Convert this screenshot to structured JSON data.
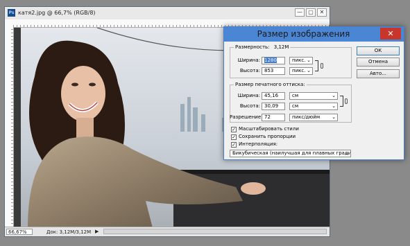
{
  "document": {
    "title": "катя2.jpg @ 66,7% (RGB/8)",
    "zoom": "66,67%",
    "doc_size": "Док: 3,12M/3,12M",
    "window_buttons": [
      "—",
      "▢",
      "✕"
    ]
  },
  "dialog": {
    "title": "Размер изображения",
    "close_glyph": "✕",
    "pixel_dimensions": {
      "label": "Размерность:",
      "size": "3,12M",
      "width_label": "Ширина:",
      "width_value": "1280",
      "width_unit": "пикс.",
      "height_label": "Высота:",
      "height_value": "853",
      "height_unit": "пикс."
    },
    "document_size": {
      "label": "Размер печатного оттиска:",
      "width_label": "Ширина:",
      "width_value": "45,16",
      "width_unit": "см",
      "height_label": "Высота:",
      "height_value": "30,09",
      "height_unit": "см",
      "resolution_label": "Разрешение:",
      "resolution_value": "72",
      "resolution_unit": "пикс/дюйм"
    },
    "checkboxes": [
      {
        "label": "Масштабировать стили",
        "checked": true
      },
      {
        "label": "Сохранить пропорции",
        "checked": true
      },
      {
        "label": "Интерполяция:",
        "checked": true
      }
    ],
    "resample_method": "Бикубическая (наилучшая для плавных градиентов)",
    "buttons": {
      "ok": "ОК",
      "cancel": "Отмена",
      "auto": "Авто..."
    }
  },
  "colors": {
    "titlebar": "#4a86d4",
    "close": "#c8352b"
  }
}
